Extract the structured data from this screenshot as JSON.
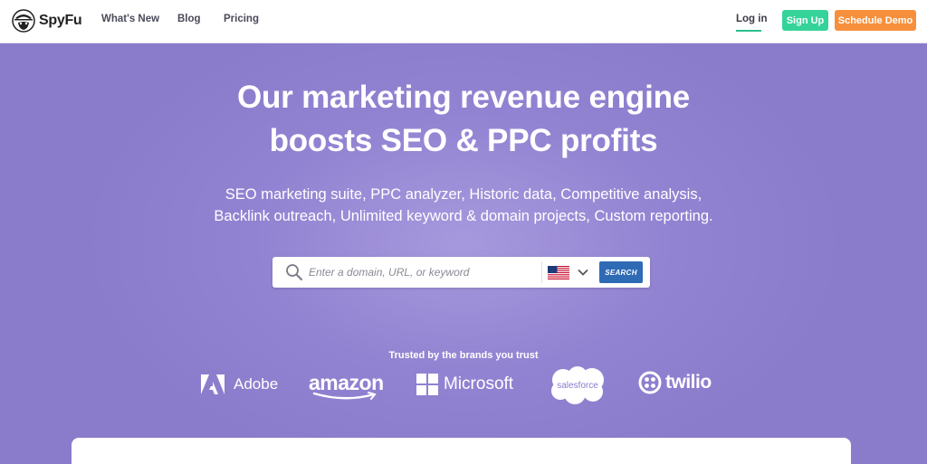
{
  "nav": {
    "brand": "SpyFu",
    "links": [
      "What's New",
      "Blog",
      "Pricing"
    ],
    "login": "Log in",
    "signup": "Sign Up",
    "demo": "Schedule Demo"
  },
  "hero": {
    "headline_line1": "Our marketing revenue engine",
    "headline_line2": "boosts SEO & PPC profits",
    "subhead_line1": "SEO marketing suite, PPC analyzer, Historic data, Competitive analysis,",
    "subhead_line2": "Backlink outreach, Unlimited keyword & domain projects, Custom reporting."
  },
  "search": {
    "placeholder": "Enter a domain, URL, or keyword",
    "value": "",
    "country_icon": "us-flag-icon",
    "button": "SEARCH"
  },
  "trusted": {
    "label": "Trusted by the brands you trust",
    "brands": [
      "Adobe",
      "amazon",
      "Microsoft",
      "salesforce",
      "twilio"
    ]
  },
  "colors": {
    "hero_bg": "#8b7ccb",
    "signup": "#35d39a",
    "demo": "#f7903c",
    "search_button": "#2f6ab5"
  }
}
